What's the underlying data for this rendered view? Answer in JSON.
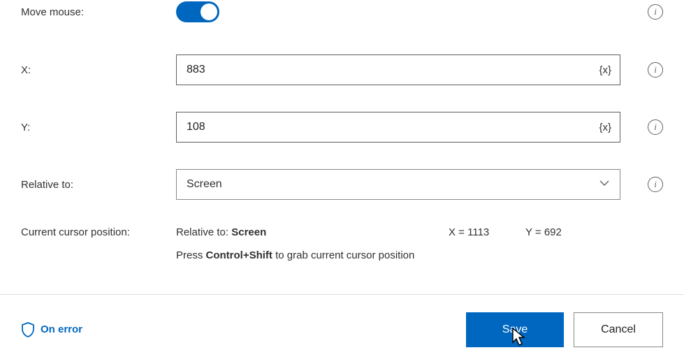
{
  "form": {
    "move_mouse": {
      "label": "Move mouse:",
      "value": true
    },
    "x": {
      "label": "X:",
      "value": "883",
      "var_hint": "{x}"
    },
    "y": {
      "label": "Y:",
      "value": "108",
      "var_hint": "{x}"
    },
    "relative_to": {
      "label": "Relative to:",
      "selected": "Screen"
    }
  },
  "cursor": {
    "label": "Current cursor position:",
    "relative_prefix": "Relative to: ",
    "relative_value": "Screen",
    "x_label": "X = ",
    "x_value": "1113",
    "y_label": "Y = ",
    "y_value": "692"
  },
  "hint": {
    "prefix": "Press ",
    "shortcut": "Control+Shift",
    "suffix": " to grab current cursor position"
  },
  "footer": {
    "on_error": "On error",
    "save": "Save",
    "cancel": "Cancel"
  }
}
